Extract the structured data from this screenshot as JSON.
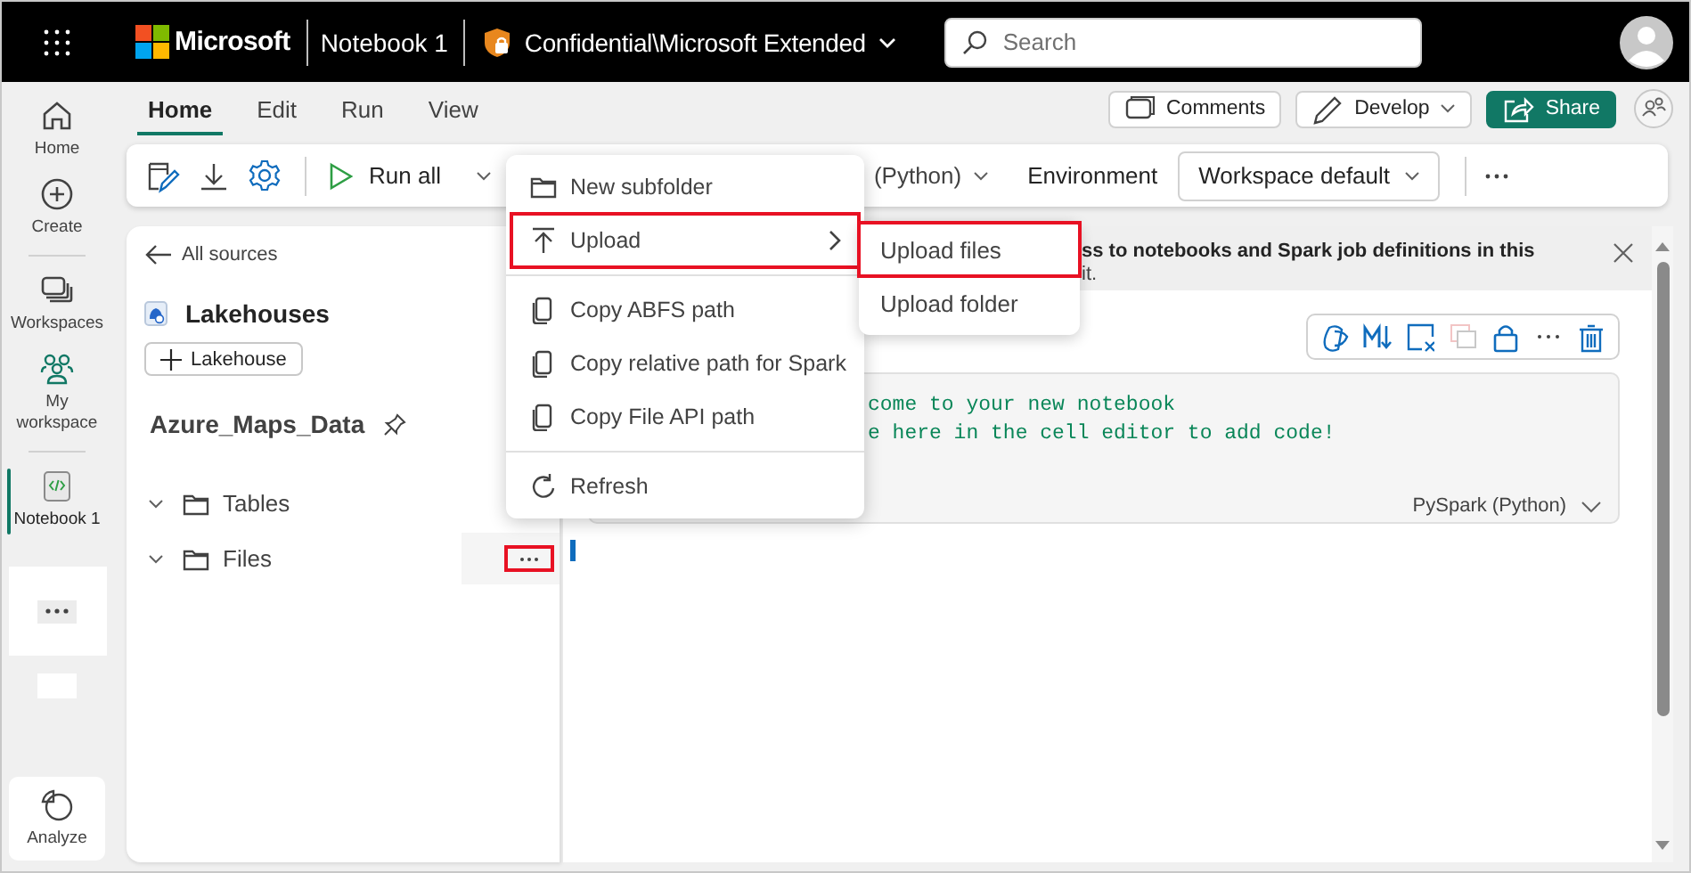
{
  "top_bar": {
    "brand": "Microsoft",
    "app_title": "Notebook 1",
    "sensitivity_label": "Confidential\\Microsoft Extended",
    "search": {
      "placeholder": "Search"
    }
  },
  "nav_rail": {
    "items": [
      {
        "label": "Home",
        "selected": false
      },
      {
        "label": "Create",
        "selected": false
      },
      {
        "label": "Workspaces",
        "selected": false
      },
      {
        "label": "My workspace",
        "selected": false
      },
      {
        "label": "Notebook 1",
        "selected": true
      }
    ],
    "bottom": {
      "label": "Analyze"
    }
  },
  "ribbon": {
    "tabs": [
      {
        "label": "Home",
        "selected": true
      },
      {
        "label": "Edit",
        "selected": false
      },
      {
        "label": "Run",
        "selected": false
      },
      {
        "label": "View",
        "selected": false
      }
    ],
    "actions": [
      {
        "label": "Comments",
        "kind": "plain"
      },
      {
        "label": "Develop",
        "kind": "dropdown"
      },
      {
        "label": "Share",
        "kind": "primary"
      }
    ],
    "toolbar": {
      "run_all": "Run all",
      "language": "(Python)",
      "environment_label": "Environment",
      "environment": "Workspace default"
    }
  },
  "explorer": {
    "back": "All sources",
    "title": "Lakehouses",
    "add_button": "Lakehouse",
    "lakehouse": "Azure_Maps_Data",
    "tree": [
      {
        "label": "Tables",
        "highlighted": false
      },
      {
        "label": "Files",
        "highlighted": true
      }
    ]
  },
  "notebook": {
    "banner": {
      "lines": [
        "ss to notebooks and Spark job definitions in this",
        "it."
      ]
    },
    "cell": {
      "code": [
        "come to your new notebook",
        "e here in the cell editor to add code!"
      ],
      "language": "PySpark (Python)"
    }
  },
  "context_menu": {
    "groups": [
      [
        {
          "label": "New subfolder",
          "submenu": false,
          "highlighted": false
        },
        {
          "label": "Upload",
          "submenu": true,
          "highlighted": true
        }
      ],
      [
        {
          "label": "Copy ABFS path",
          "submenu": false,
          "highlighted": false
        },
        {
          "label": "Copy relative path for Spark",
          "submenu": false,
          "highlighted": false
        },
        {
          "label": "Copy File API path",
          "submenu": false,
          "highlighted": false
        }
      ],
      [
        {
          "label": "Refresh",
          "submenu": false,
          "highlighted": false
        }
      ]
    ]
  },
  "submenu": {
    "items": [
      {
        "label": "Upload files",
        "highlighted": true
      },
      {
        "label": "Upload folder",
        "highlighted": false
      }
    ]
  }
}
